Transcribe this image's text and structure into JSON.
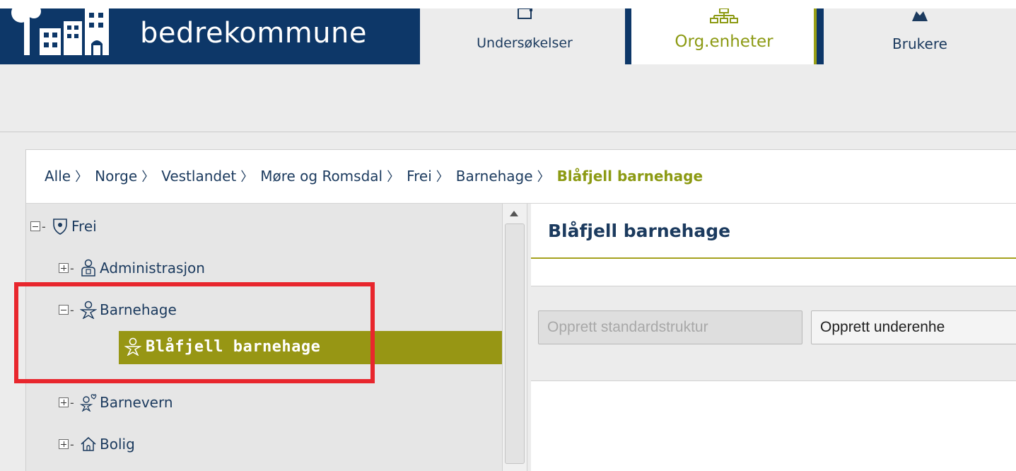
{
  "brand": {
    "name": "bedrekommune",
    "colors": {
      "navy": "#0d3768",
      "olive": "#979614",
      "accent_text": "#8c9a13",
      "highlight": "#e8262d"
    }
  },
  "nav": {
    "tabs": [
      {
        "label": "Undersøkelser",
        "icon": "survey-icon",
        "active": false
      },
      {
        "label": "Org.enheter",
        "icon": "org-chart-icon",
        "active": true
      },
      {
        "label": "Brukere",
        "icon": "users-icon",
        "active": false
      }
    ]
  },
  "breadcrumb": {
    "items": [
      "Alle",
      "Norge",
      "Vestlandet",
      "Møre og Romsdal",
      "Frei",
      "Barnehage"
    ],
    "current": "Blåfjell barnehage",
    "separator": "〉"
  },
  "tree": {
    "root": {
      "label": "Frei",
      "icon": "shield-icon",
      "expanded": true
    },
    "children": [
      {
        "label": "Administrasjon",
        "icon": "person-admin-icon",
        "expanded": false
      },
      {
        "label": "Barnehage",
        "icon": "child-icon",
        "expanded": true
      },
      {
        "label": "Blåfjell barnehage",
        "icon": "child-icon",
        "selected": true
      },
      {
        "label": "Barnevern",
        "icon": "child-heart-icon",
        "expanded": false
      },
      {
        "label": "Bolig",
        "icon": "house-icon",
        "expanded": false
      }
    ]
  },
  "detail": {
    "title": "Blåfjell barnehage",
    "buttons": {
      "create_standard": "Opprett standardstruktur",
      "create_subunit": "Opprett underenhe"
    }
  }
}
